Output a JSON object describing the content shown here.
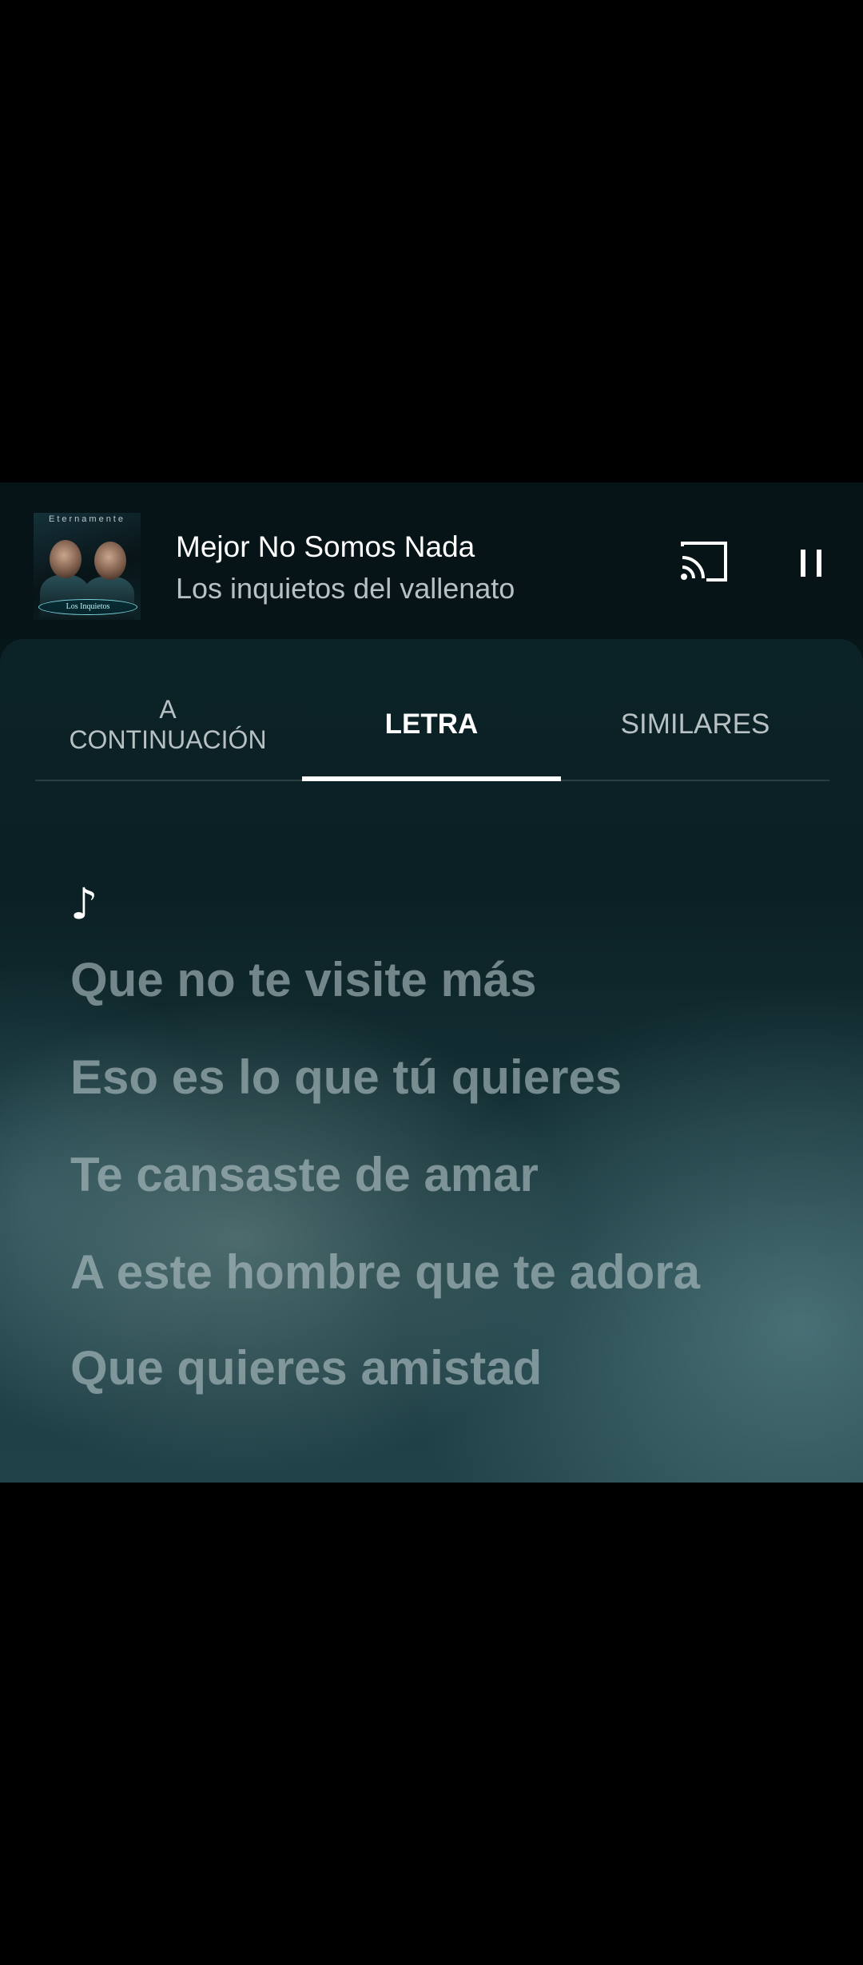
{
  "now_playing": {
    "title": "Mejor No Somos Nada",
    "artist": "Los inquietos del vallenato",
    "album_art": {
      "caption": "Eternamente",
      "logo_text": "Los Inquietos"
    }
  },
  "controls": {
    "cast_icon": "cast-icon",
    "pause_icon": "pause-icon"
  },
  "tabs": [
    {
      "label": "A CONTINUACIÓN",
      "selected": false
    },
    {
      "label": "LETRA",
      "selected": true
    },
    {
      "label": "SIMILARES",
      "selected": false
    }
  ],
  "lyrics": {
    "lead_symbol": "♪",
    "lines": [
      "Que no te visite más",
      "Eso es lo que tú quieres",
      "Te cansaste de amar",
      "A este hombre que te adora",
      "Que quieres amistad"
    ]
  },
  "colors": {
    "background": "#000000",
    "player_background": "#071619",
    "text_primary": "#ffffff",
    "text_secondary": "#b7c0c2"
  }
}
